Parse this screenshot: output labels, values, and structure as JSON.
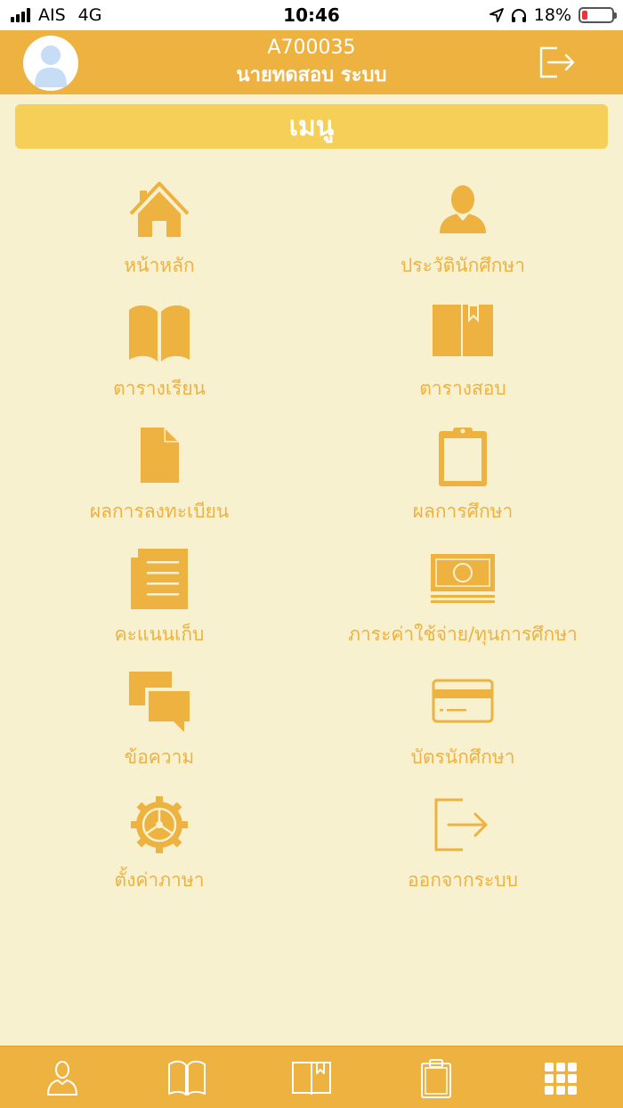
{
  "status_bar": {
    "carrier": "AIS",
    "network": "4G",
    "time": "10:46",
    "battery_percent": "18%",
    "battery_level": 0.18
  },
  "header": {
    "user_id": "A700035",
    "user_name": "นายทดสอบ ระบบ",
    "avatar_icon": "user-avatar-icon",
    "logout_icon": "logout-icon"
  },
  "menu": {
    "title": "เมนู",
    "items": [
      {
        "label": "หน้าหลัก",
        "icon": "home-icon"
      },
      {
        "label": "ประวัตินักศึกษา",
        "icon": "person-icon"
      },
      {
        "label": "ตารางเรียน",
        "icon": "open-book-icon"
      },
      {
        "label": "ตารางสอบ",
        "icon": "bookmark-book-icon"
      },
      {
        "label": "ผลการลงทะเบียน",
        "icon": "document-icon"
      },
      {
        "label": "ผลการศึกษา",
        "icon": "clipboard-icon"
      },
      {
        "label": "คะแนนเก็บ",
        "icon": "newspaper-icon"
      },
      {
        "label": "ภาระค่าใช้จ่าย/ทุนการศึกษา",
        "icon": "money-icon"
      },
      {
        "label": "ข้อความ",
        "icon": "chat-bubbles-icon"
      },
      {
        "label": "บัตรนักศึกษา",
        "icon": "card-icon"
      },
      {
        "label": "ตั้งค่าภาษา",
        "icon": "gear-icon"
      },
      {
        "label": "ออกจากระบบ",
        "icon": "logout-icon"
      }
    ]
  },
  "tabbar": {
    "tabs": [
      {
        "icon": "person-outline-icon"
      },
      {
        "icon": "open-book-outline-icon"
      },
      {
        "icon": "bookmark-book-outline-icon"
      },
      {
        "icon": "clipboard-outline-icon"
      },
      {
        "icon": "grid-menu-icon",
        "active": true
      }
    ]
  },
  "colors": {
    "accent": "#edb240",
    "background": "#f8f1d0",
    "menu_bar": "#f5cf57",
    "avatar": "#c7dcf5"
  }
}
